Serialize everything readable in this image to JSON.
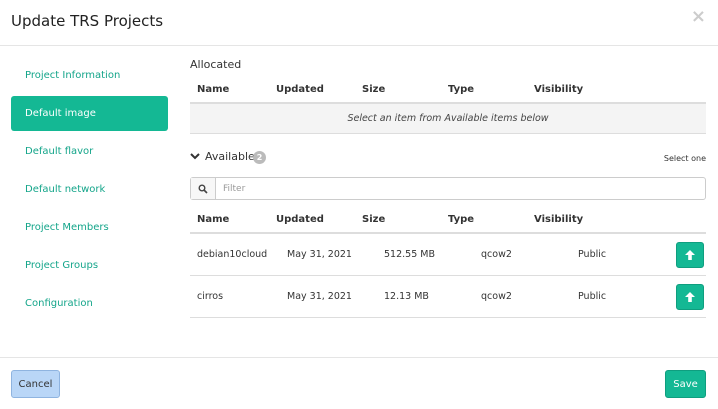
{
  "modal": {
    "title": "Update TRS Projects",
    "close_label": "×"
  },
  "sidebar": {
    "items": [
      {
        "label": "Project Information",
        "active": false
      },
      {
        "label": "Default image",
        "active": true
      },
      {
        "label": "Default flavor",
        "active": false
      },
      {
        "label": "Default network",
        "active": false
      },
      {
        "label": "Project Members",
        "active": false
      },
      {
        "label": "Project Groups",
        "active": false
      },
      {
        "label": "Configuration",
        "active": false
      }
    ]
  },
  "allocated": {
    "title": "Allocated",
    "columns": [
      "Name",
      "Updated",
      "Size",
      "Type",
      "Visibility"
    ],
    "empty_message": "Select an item from Available items below"
  },
  "available": {
    "title": "Available",
    "count": "2",
    "select_hint": "Select one",
    "filter_placeholder": "Filter",
    "columns": [
      "Name",
      "Updated",
      "Size",
      "Type",
      "Visibility"
    ],
    "rows": [
      {
        "name": "debian10cloud",
        "updated": "May 31, 2021",
        "size": "512.55 MB",
        "type": "qcow2",
        "visibility": "Public"
      },
      {
        "name": "cirros",
        "updated": "May 31, 2021",
        "size": "12.13 MB",
        "type": "qcow2",
        "visibility": "Public"
      }
    ]
  },
  "footer": {
    "cancel_label": "Cancel",
    "save_label": "Save"
  },
  "colors": {
    "accent": "#14b894",
    "link": "#14a58a",
    "cancel_bg": "#b9d6f7"
  },
  "icons": {
    "close": "close-icon",
    "chevron": "chevron-down-icon",
    "filter": "search-icon",
    "allocate": "arrow-up-icon"
  }
}
